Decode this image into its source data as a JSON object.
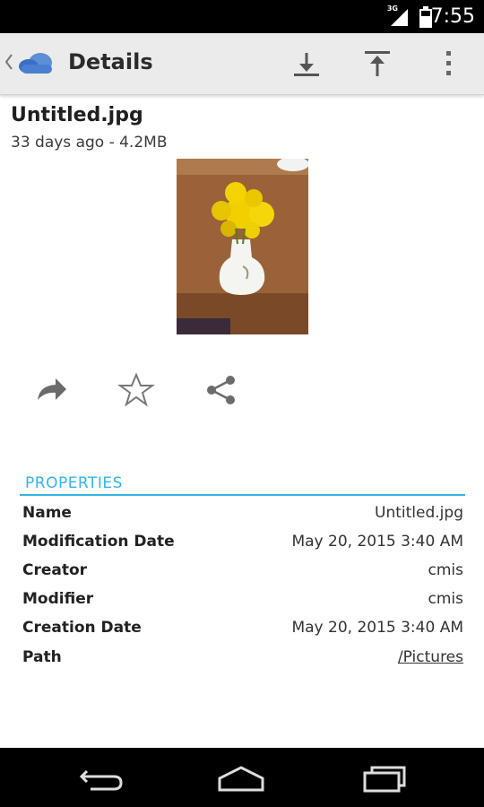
{
  "status_bar": {
    "time": "7:55",
    "network": "3G"
  },
  "action_bar": {
    "title": "Details",
    "download_icon": "download-icon",
    "upload_icon": "upload-icon",
    "menu_icon": "overflow-menu-icon"
  },
  "file": {
    "name": "Untitled.jpg",
    "meta": "33 days ago - 4.2MB"
  },
  "actions": {
    "forward_icon": "forward-arrow-icon",
    "favorite_icon": "star-icon",
    "share_icon": "share-icon"
  },
  "properties": {
    "header": "PROPERTIES",
    "rows": [
      {
        "label": "Name",
        "value": "Untitled.jpg"
      },
      {
        "label": "Modification Date",
        "value": "May 20, 2015 3:40 AM"
      },
      {
        "label": "Creator",
        "value": "cmis"
      },
      {
        "label": "Modifier",
        "value": "cmis"
      },
      {
        "label": "Creation Date",
        "value": "May 20, 2015 3:40 AM"
      },
      {
        "label": "Path",
        "value": "/Pictures"
      }
    ]
  },
  "colors": {
    "accent": "#33b5e5",
    "action_bar": "#ebebeb",
    "status_bar": "#000000"
  }
}
